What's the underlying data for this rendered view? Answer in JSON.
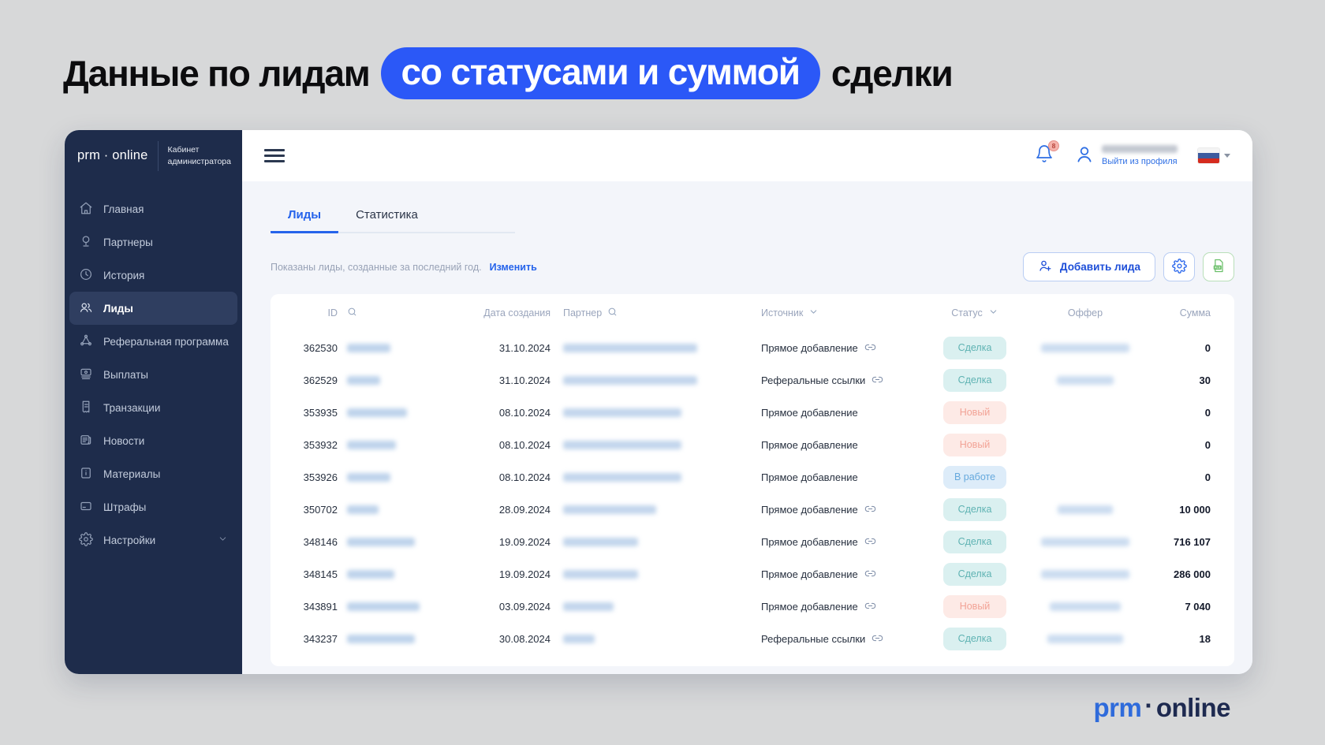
{
  "page": {
    "title_prefix": "Данные по лидам",
    "title_highlight": "со статусами и суммой",
    "title_suffix": "сделки"
  },
  "branding": {
    "sidebar_logo": "prm · online",
    "cabinet_line1": "Кабинет",
    "cabinet_line2": "администратора",
    "footer_prm": "prm",
    "footer_dot": "·",
    "footer_online": "online",
    "accent_blue": "#2b58f7",
    "sidebar_navy": "#1e2c4b"
  },
  "sidebar": {
    "active_index": 3,
    "items": [
      {
        "label": "Главная",
        "icon": "home"
      },
      {
        "label": "Партнеры",
        "icon": "partners"
      },
      {
        "label": "История",
        "icon": "history"
      },
      {
        "label": "Лиды",
        "icon": "leads"
      },
      {
        "label": "Реферальная программа",
        "icon": "referral"
      },
      {
        "label": "Выплаты",
        "icon": "payouts"
      },
      {
        "label": "Транзакции",
        "icon": "transactions"
      },
      {
        "label": "Новости",
        "icon": "news"
      },
      {
        "label": "Материалы",
        "icon": "materials"
      },
      {
        "label": "Штрафы",
        "icon": "penalties"
      },
      {
        "label": "Настройки",
        "icon": "settings",
        "has_chevron": true
      }
    ]
  },
  "topbar": {
    "notification_badge": "8",
    "logout_label": "Выйти из профиля"
  },
  "tabs": [
    {
      "label": "Лиды",
      "active": true
    },
    {
      "label": "Статистика",
      "active": false
    }
  ],
  "filter": {
    "text": "Показаны лиды, созданные за последний год.",
    "link": "Изменить"
  },
  "actions": {
    "add_lead": "Добавить лида"
  },
  "statuses": {
    "deal": {
      "label": "Сделка",
      "bg": "#daf0f0",
      "color": "#5fb3b3"
    },
    "new": {
      "label": "Новый",
      "bg": "#fdeae6",
      "color": "#f2a396"
    },
    "work": {
      "label": "В работе",
      "bg": "#ddecf9",
      "color": "#66a9dd"
    }
  },
  "table": {
    "columns": [
      "ID",
      "Дата создания",
      "Партнер",
      "Источник",
      "Статус",
      "Оффер",
      "Сумма"
    ],
    "rows": [
      {
        "id": "362530",
        "date": "31.10.2024",
        "source": "Прямое добавление",
        "has_link": true,
        "status": "deal",
        "sum": "0",
        "name_w": 55,
        "partner_w": 170,
        "offer_w": 112
      },
      {
        "id": "362529",
        "date": "31.10.2024",
        "source": "Реферальные ссылки",
        "has_link": true,
        "status": "deal",
        "sum": "30",
        "name_w": 42,
        "partner_w": 170,
        "offer_w": 72
      },
      {
        "id": "353935",
        "date": "08.10.2024",
        "source": "Прямое добавление",
        "has_link": false,
        "status": "new",
        "sum": "0",
        "name_w": 76,
        "partner_w": 150,
        "offer_w": 0
      },
      {
        "id": "353932",
        "date": "08.10.2024",
        "source": "Прямое добавление",
        "has_link": false,
        "status": "new",
        "sum": "0",
        "name_w": 62,
        "partner_w": 150,
        "offer_w": 0
      },
      {
        "id": "353926",
        "date": "08.10.2024",
        "source": "Прямое добавление",
        "has_link": false,
        "status": "work",
        "sum": "0",
        "name_w": 55,
        "partner_w": 150,
        "offer_w": 0
      },
      {
        "id": "350702",
        "date": "28.09.2024",
        "source": "Прямое добавление",
        "has_link": true,
        "status": "deal",
        "sum": "10 000",
        "name_w": 40,
        "partner_w": 118,
        "offer_w": 70
      },
      {
        "id": "348146",
        "date": "19.09.2024",
        "source": "Прямое добавление",
        "has_link": true,
        "status": "deal",
        "sum": "716 107",
        "name_w": 86,
        "partner_w": 95,
        "offer_w": 112
      },
      {
        "id": "348145",
        "date": "19.09.2024",
        "source": "Прямое добавление",
        "has_link": true,
        "status": "deal",
        "sum": "286 000",
        "name_w": 60,
        "partner_w": 95,
        "offer_w": 112
      },
      {
        "id": "343891",
        "date": "03.09.2024",
        "source": "Прямое добавление",
        "has_link": true,
        "status": "new",
        "sum": "7 040",
        "name_w": 92,
        "partner_w": 64,
        "offer_w": 90
      },
      {
        "id": "343237",
        "date": "30.08.2024",
        "source": "Реферальные ссылки",
        "has_link": true,
        "status": "deal",
        "sum": "18",
        "name_w": 86,
        "partner_w": 40,
        "offer_w": 96
      }
    ]
  }
}
